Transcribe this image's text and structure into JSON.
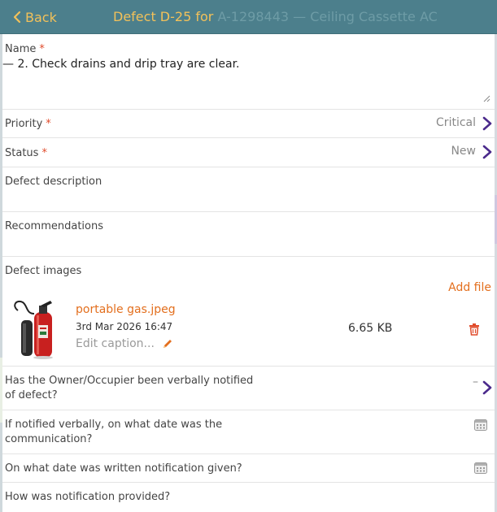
{
  "header": {
    "back_label": "Back",
    "title_main": "Defect D-25 for",
    "title_faded": "A-1298443 — Ceiling Cassette AC"
  },
  "name": {
    "label": "Name",
    "required_mark": "*",
    "value": "— 2. Check drains and drip tray are clear."
  },
  "priority": {
    "label": "Priority",
    "required_mark": "*",
    "value": "Critical"
  },
  "status": {
    "label": "Status",
    "required_mark": "*",
    "value": "New"
  },
  "defect_description": {
    "label": "Defect description"
  },
  "recommendations": {
    "label": "Recommendations"
  },
  "defect_images": {
    "label": "Defect images",
    "add_file_label": "Add file",
    "files": [
      {
        "file_name": "portable gas.jpeg",
        "date": "3rd Mar 2026 16:47",
        "caption_placeholder": "Edit caption...",
        "size": "6.65 KB"
      }
    ]
  },
  "owner_notified": {
    "label_line1": "Has the Owner/Occupier been verbally notified",
    "label_line2": "of defect?",
    "value": "–"
  },
  "verbal_date": {
    "label_line1": "If notified verbally, on what date was the",
    "label_line2": "communication?"
  },
  "written_date": {
    "label": "On what date was written notification given?"
  },
  "notification_method": {
    "label": "How was notification provided?"
  },
  "colors": {
    "header_bg": "#4c7f8c",
    "accent_yellow": "#f2c15a",
    "accent_orange": "#e36f1e",
    "required_red": "#e04b2b",
    "chevron_purple": "#4b2a8c"
  },
  "icons": [
    "back-chevron-icon",
    "chevron-right-icon",
    "resize-grip-icon",
    "trash-icon",
    "pencil-icon",
    "calendar-icon"
  ]
}
